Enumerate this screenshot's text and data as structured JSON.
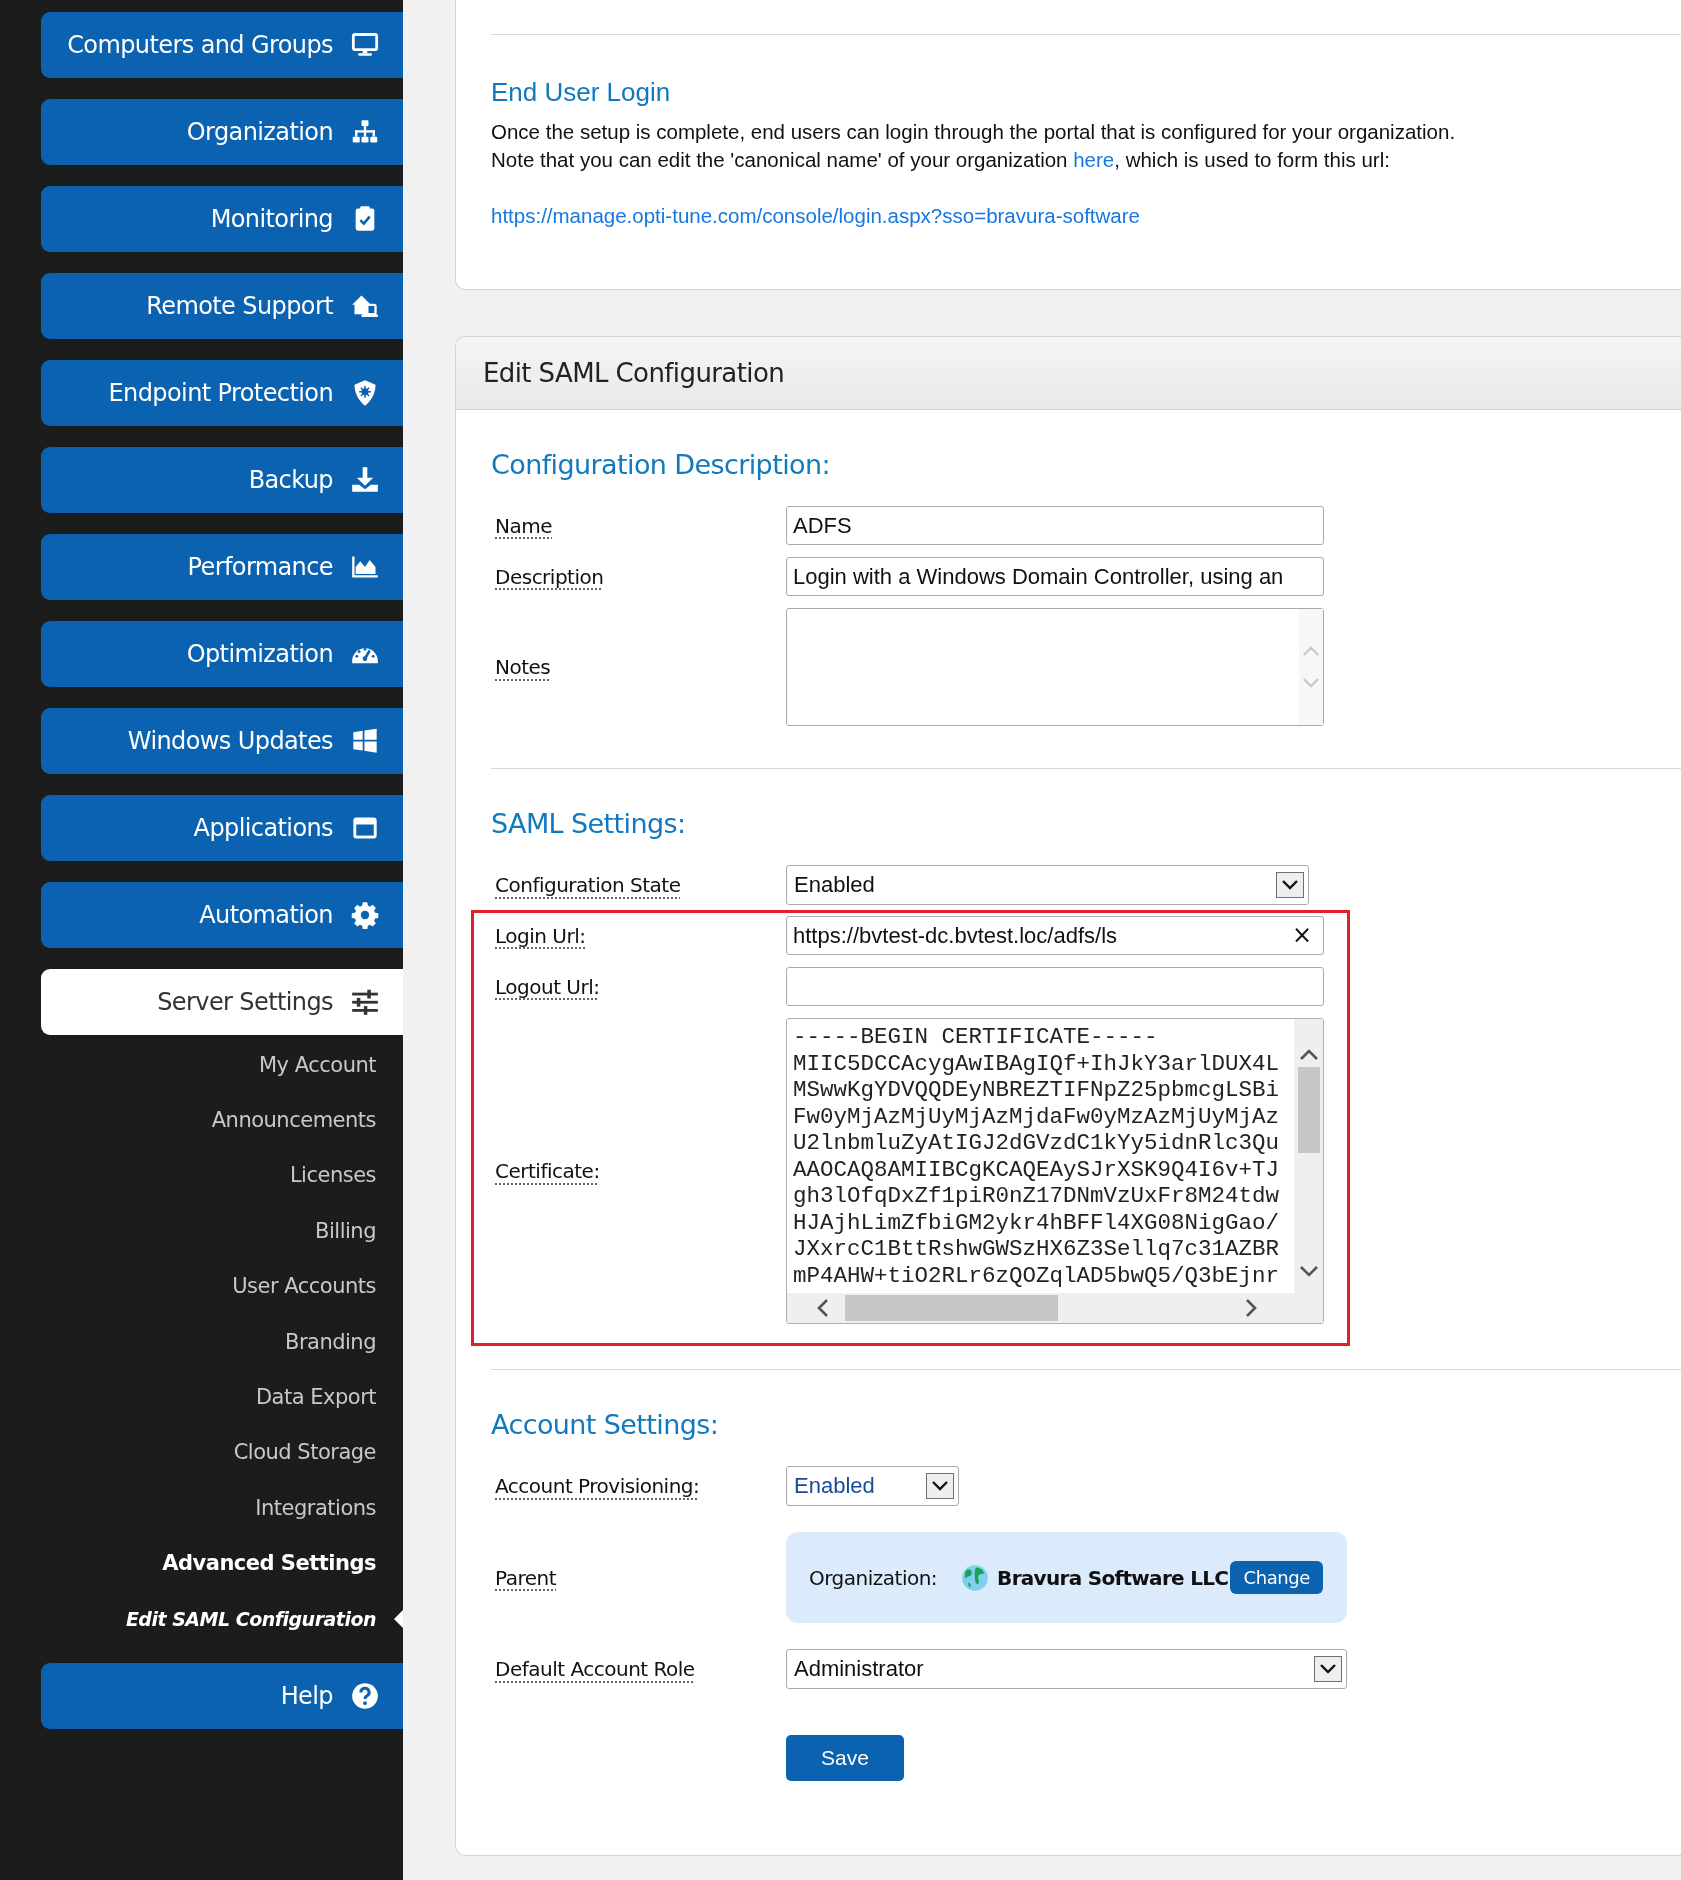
{
  "sidebar": {
    "items": [
      {
        "label": "Computers and Groups",
        "selected": false
      },
      {
        "label": "Organization",
        "selected": false
      },
      {
        "label": "Monitoring",
        "selected": false
      },
      {
        "label": "Remote Support",
        "selected": false
      },
      {
        "label": "Endpoint Protection",
        "selected": false
      },
      {
        "label": "Backup",
        "selected": false
      },
      {
        "label": "Performance",
        "selected": false
      },
      {
        "label": "Optimization",
        "selected": false
      },
      {
        "label": "Windows Updates",
        "selected": false
      },
      {
        "label": "Applications",
        "selected": false
      },
      {
        "label": "Automation",
        "selected": false
      },
      {
        "label": "Server Settings",
        "selected": true,
        "children": [
          {
            "label": "My Account",
            "selected": false,
            "expanded": false
          },
          {
            "label": "Announcements",
            "selected": false,
            "expanded": false
          },
          {
            "label": "Licenses",
            "selected": false,
            "expanded": false
          },
          {
            "label": "Billing",
            "selected": false,
            "expanded": false
          },
          {
            "label": "User Accounts",
            "selected": false,
            "expanded": false
          },
          {
            "label": "Branding",
            "selected": false,
            "expanded": false
          },
          {
            "label": "Data Export",
            "selected": false,
            "expanded": false
          },
          {
            "label": "Cloud Storage",
            "selected": false,
            "expanded": false
          },
          {
            "label": "Integrations",
            "selected": false,
            "expanded": false
          },
          {
            "label": "Advanced Settings",
            "selected": false,
            "expanded": true,
            "children": [
              {
                "label": "Edit SAML Configuration",
                "selected": true
              }
            ]
          }
        ]
      },
      {
        "label": "Help",
        "selected": false
      }
    ]
  },
  "end_user_login": {
    "title": "End User Login",
    "paragraph_1": "Once the setup is complete, end users can login through the portal that is configured for your organization.",
    "paragraph_2": {
      "before": "Note that you can edit the 'canonical name' of your organization ",
      "link": "here",
      "after": ", which is used to form this url:"
    },
    "url": "https://manage.opti-tune.com/console/login.aspx?sso=bravura-software"
  },
  "saml_config": {
    "title": "Edit SAML Configuration",
    "sections": [
      {
        "title": "Configuration Description:",
        "fields": [
          {
            "kind": "text",
            "label": "Name",
            "value": "ADFS",
            "highlighted": false
          },
          {
            "kind": "text",
            "label": "Description",
            "value": "Login with a Windows Domain Controller, using an",
            "highlighted": false
          },
          {
            "kind": "textarea",
            "label": "Notes",
            "highlighted": false
          }
        ]
      },
      {
        "title": "SAML Settings:",
        "fields": [
          {
            "kind": "select",
            "label": "Configuration State",
            "value": "Enabled",
            "highlighted": false
          },
          {
            "kind": "text",
            "label": "Login Url:",
            "value": "https://bvtest-dc.bvtest.loc/adfs/ls",
            "clear_button": "×",
            "highlighted": true
          },
          {
            "kind": "text",
            "label": "Logout Url:",
            "highlighted": true
          },
          {
            "kind": "certificate",
            "label": "Certificate:",
            "highlighted": true,
            "lines": [
              "-----BEGIN CERTIFICATE-----",
              "MIIC5DCCAcygAwIBAgIQf+IhJkY3arlDUX4L",
              "MSwwKgYDVQQDEyNBREZTIFNpZ25pbmcgLSBi",
              "Fw0yMjAzMjUyMjAzMjdaFw0yMzAzMjUyMjAz",
              "U2lnbmluZyAtIGJ2dGVzdC1kYy5idnRlc3Qu",
              "AAOCAQ8AMIIBCgKCAQEAySJrXSK9Q4I6v+TJ",
              "gh3lOfqDxZf1piR0nZ17DNmVzUxFr8M24tdw",
              "HJAjhLimZfbiGM2ykr4hBFFl4XG08NigGao/",
              "JXxrcC1BttRshwGWSzHX6Z3Sellq7c31AZBR",
              "mP4AHW+tiO2RLr6zQOZqlAD5bwQ5/Q3bEjnr"
            ]
          }
        ]
      },
      {
        "title": "Account Settings:",
        "fields": [
          {
            "kind": "compact-select",
            "label": "Account Provisioning:",
            "value": "Enabled",
            "highlighted": false
          },
          {
            "kind": "organization",
            "label": "Parent",
            "caption": "Organization:",
            "name": "Bravura Software LLC",
            "button": "Change",
            "highlighted": false
          },
          {
            "kind": "select",
            "label": "Default Account Role",
            "value": "Administrator",
            "highlighted": false
          }
        ]
      }
    ],
    "save_button": "Save"
  }
}
